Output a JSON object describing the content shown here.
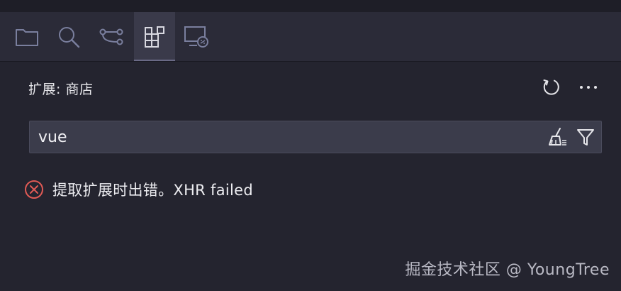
{
  "activity_bar": {
    "tabs": [
      {
        "icon": "folder-icon",
        "label": "explorer"
      },
      {
        "icon": "search-icon",
        "label": "search"
      },
      {
        "icon": "source-control-icon",
        "label": "source-control"
      },
      {
        "icon": "extensions-icon",
        "label": "extensions",
        "active": true
      },
      {
        "icon": "remote-explorer-icon",
        "label": "remote-explorer"
      }
    ]
  },
  "panel": {
    "title": "扩展: 商店",
    "actions": {
      "refresh_icon": "refresh-icon",
      "more_icon": "more-icon"
    }
  },
  "search": {
    "value": "vue",
    "placeholder": "",
    "tools": {
      "clear_icon": "clear-filter-icon",
      "filter_icon": "filter-icon"
    }
  },
  "error": {
    "icon": "error-icon",
    "message": "提取扩展时出错。XHR failed"
  },
  "watermark": {
    "text": "掘金技术社区 @ YoungTree"
  },
  "colors": {
    "background": "#24242f",
    "activity_bar": "#2b2b38",
    "active_tab": "#3a3a4a",
    "icon": "#7a7f9e",
    "error": "#e05a55",
    "search_bg": "#3b3c4b"
  }
}
